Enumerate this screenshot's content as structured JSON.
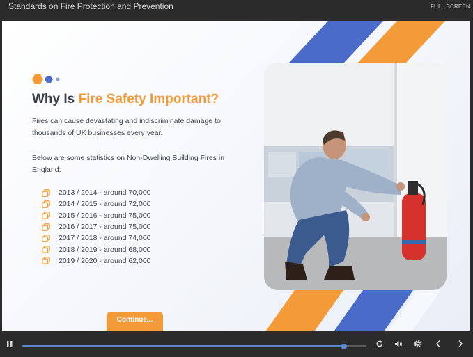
{
  "window": {
    "title": "Standards on Fire Protection and Prevention",
    "fullscreen_label": "FULL SCREEN"
  },
  "slide": {
    "heading_prefix": "Why Is ",
    "heading_accent": "Fire Safety Important?",
    "paragraph1": "Fires can cause devastating and indiscriminate damage to thousands of UK businesses every year.",
    "paragraph2": "Below are some statistics on Non-Dwelling Building Fires in England:",
    "stats": [
      "2013 / 2014 - around 70,000",
      "2014 / 2015 - around 72,000",
      "2015 / 2016 - around 75,000",
      "2016 / 2017 - around 75,000",
      "2017 / 2018 - around 74,000",
      "2018 / 2019 - around 68,000",
      "2019 / 2020 - around 62,000"
    ],
    "continue_label": "Continue..."
  },
  "player": {
    "progress": 0.935
  },
  "colors": {
    "accent_orange": "#f29b38",
    "accent_blue": "#4a6bc8",
    "player_bar": "#2b2b2b"
  }
}
